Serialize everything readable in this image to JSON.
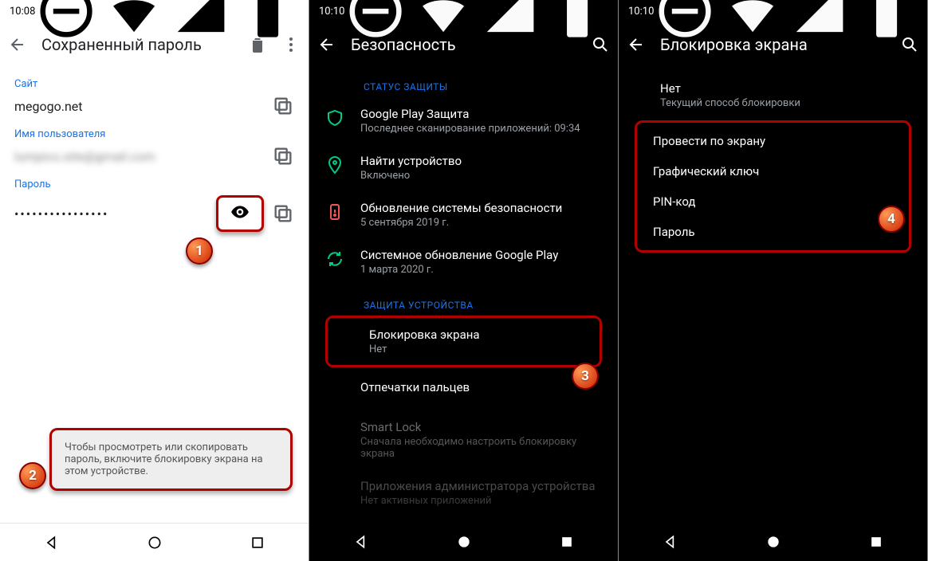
{
  "phone1": {
    "time": "10:08",
    "title": "Сохраненный пароль",
    "site_label": "Сайт",
    "site_value": "megogo.net",
    "user_label": "Имя пользователя",
    "user_value": "lumpico.site@gmail.com",
    "password_label": "Пароль",
    "password_value": "••••••••••••••••",
    "toast": "Чтобы просмотреть или скопировать пароль, включите блокировку экрана на этом устройстве."
  },
  "phone2": {
    "time": "10:10",
    "title": "Безопасность",
    "section1": "СТАТУС ЗАЩИТЫ",
    "section2": "ЗАЩИТА УСТРОЙСТВА",
    "items": {
      "play": {
        "t": "Google Play Защита",
        "s": "Последнее сканирование приложений: 09:34"
      },
      "find": {
        "t": "Найти устройство",
        "s": "Включено"
      },
      "update": {
        "t": "Обновление системы безопасности",
        "s": "5 сентября 2019 г."
      },
      "sys": {
        "t": "Системное обновление Google Play",
        "s": "1 марта 2020 г."
      },
      "lock": {
        "t": "Блокировка экрана",
        "s": "Нет"
      },
      "finger": {
        "t": "Отпечатки пальцев"
      },
      "smart": {
        "t": "Smart Lock",
        "s": "Сначала необходимо настроить блокировку экрана"
      },
      "admin": {
        "t": "Приложения администратора устройства",
        "s": "Нет активных приложений"
      }
    }
  },
  "phone3": {
    "time": "10:10",
    "title": "Блокировка экрана",
    "current": {
      "t": "Нет",
      "s": "Текущий способ блокировки"
    },
    "options": {
      "swipe": "Провести по экрану",
      "pattern": "Графический ключ",
      "pin": "PIN-код",
      "password": "Пароль"
    }
  },
  "badges": {
    "b1": "1",
    "b2": "2",
    "b3": "3",
    "b4": "4"
  }
}
